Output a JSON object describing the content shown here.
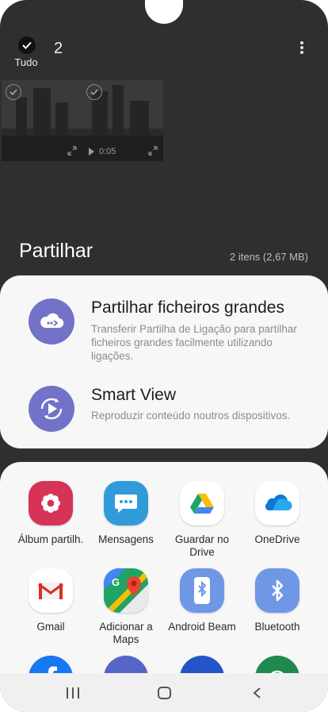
{
  "header": {
    "select_all_label": "Tudo",
    "selected_count": "2",
    "more_icon": "more-vert-icon"
  },
  "thumbnails": [
    {
      "kind": "image"
    },
    {
      "kind": "video",
      "duration": "0:05"
    }
  ],
  "share": {
    "title": "Partilhar",
    "meta": "2 itens (2,67 MB)"
  },
  "options": [
    {
      "title": "Partilhar ficheiros grandes",
      "description": "Transferir Partilha de Ligação para partilhar ficheiros grandes facilmente utilizando ligações.",
      "icon": "cloud-share-icon",
      "color": "#7272c9"
    },
    {
      "title": "Smart View",
      "description": "Reproduzir conteúdo noutros dispositivos.",
      "icon": "smart-view-icon",
      "color": "#7272c9"
    }
  ],
  "apps": [
    {
      "label": "Álbum partilh.",
      "icon": "shared-album-icon",
      "color": "#d63357"
    },
    {
      "label": "Mensagens",
      "icon": "messages-icon",
      "color": "#2f9bd9"
    },
    {
      "label": "Guardar no Drive",
      "icon": "google-drive-icon",
      "color": "#ffffff"
    },
    {
      "label": "OneDrive",
      "icon": "onedrive-icon",
      "color": "#ffffff"
    },
    {
      "label": "Gmail",
      "icon": "gmail-icon",
      "color": "#ffffff"
    },
    {
      "label": "Adicionar a Maps",
      "icon": "google-maps-icon",
      "color": "#ffffff"
    },
    {
      "label": "Android Beam",
      "icon": "android-beam-icon",
      "color": "#6f97e6"
    },
    {
      "label": "Bluetooth",
      "icon": "bluetooth-icon",
      "color": "#6f97e6"
    },
    {
      "label": "",
      "icon": "facebook-icon",
      "color": "#1877f2"
    },
    {
      "label": "",
      "icon": "app-icon-partial",
      "color": "#5565c8"
    },
    {
      "label": "",
      "icon": "app-icon-partial",
      "color": "#2255c8"
    },
    {
      "label": "",
      "icon": "app-icon-partial",
      "color": "#1f8a4d"
    }
  ],
  "navbar": {
    "recent_icon": "recent-apps-icon",
    "home_icon": "home-icon",
    "back_icon": "back-icon"
  }
}
